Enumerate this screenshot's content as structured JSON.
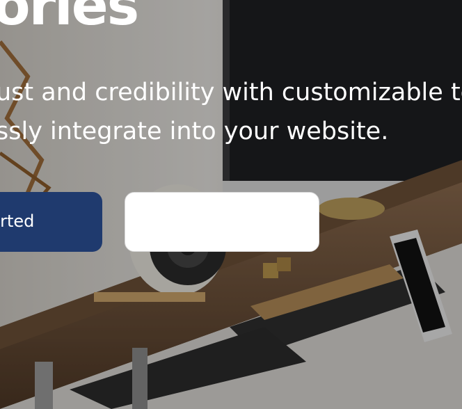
{
  "hero": {
    "title": "ories",
    "subtitle_line1": "ust and credibility with customizable te",
    "subtitle_line2": "ssly integrate into your website.",
    "primary_button_label": "tarted",
    "secondary_button_label": ""
  },
  "colors": {
    "primary_button": "#1f3a6e",
    "secondary_button": "#ffffff",
    "text": "#ffffff"
  }
}
